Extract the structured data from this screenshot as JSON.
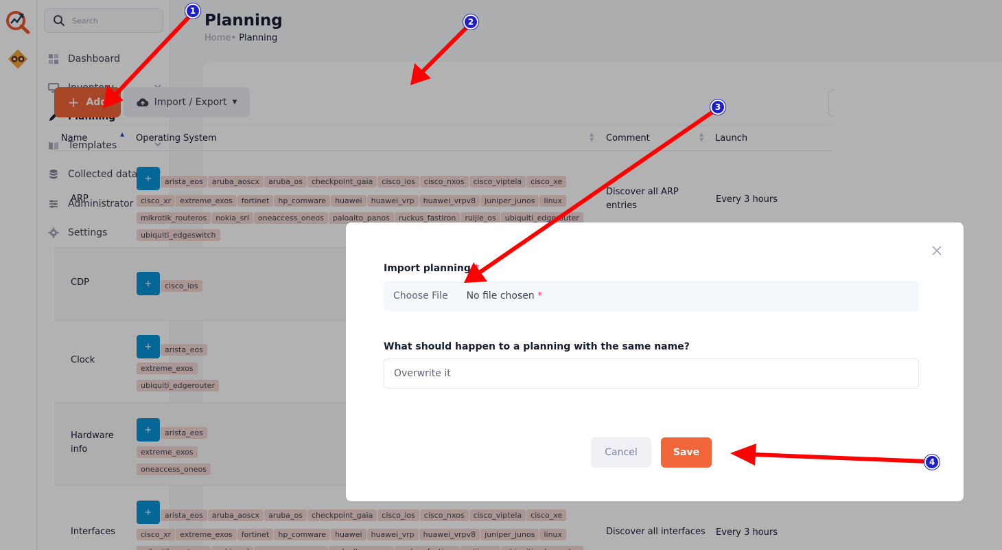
{
  "search": {
    "placeholder": "Search"
  },
  "sidebar": {
    "items": [
      {
        "label": "Dashboard",
        "expandable": false
      },
      {
        "label": "Inventory",
        "expandable": true
      },
      {
        "label": "Planning",
        "expandable": false,
        "active": true
      },
      {
        "label": "Templates",
        "expandable": true
      },
      {
        "label": "Collected data",
        "expandable": true
      },
      {
        "label": "Administrator",
        "expandable": true
      },
      {
        "label": "Settings",
        "expandable": false
      }
    ]
  },
  "page": {
    "title": "Planning",
    "breadcrumb_home": "Home",
    "breadcrumb_sep": "•",
    "breadcrumb_current": "Planning"
  },
  "toolbar": {
    "add_label": "Add",
    "import_export_label": "Import / Export"
  },
  "table": {
    "columns": [
      "Name",
      "Operating System",
      "Comment",
      "Launch"
    ],
    "plus_label": "+",
    "rows": [
      {
        "name": "ARP",
        "comment": "Discover all ARP entries",
        "launch": "Every 3 hours",
        "tags": [
          "arista_eos",
          "aruba_aoscx",
          "aruba_os",
          "checkpoint_gaia",
          "cisco_ios",
          "cisco_nxos",
          "cisco_viptela",
          "cisco_xe",
          "cisco_xr",
          "extreme_exos",
          "fortinet",
          "hp_comware",
          "huawei",
          "huawei_vrp",
          "huawei_vrpv8",
          "juniper_junos",
          "linux",
          "mikrotik_routeros",
          "nokia_srl",
          "oneaccess_oneos",
          "paloalto_panos",
          "ruckus_fastiron",
          "ruijie_os",
          "ubiquiti_edgerouter",
          "ubiquiti_edgeswitch"
        ]
      },
      {
        "name": "CDP",
        "comment": "",
        "launch": "",
        "tags": [
          "cisco_ios"
        ]
      },
      {
        "name": "Clock",
        "comment": "",
        "launch": "",
        "tags": [
          "arista_eos",
          "extreme_exos",
          "ubiquiti_edgerouter"
        ]
      },
      {
        "name": "Hardware info",
        "comment": "",
        "launch": "",
        "tags": [
          "arista_eos",
          "extreme_exos",
          "oneaccess_oneos"
        ]
      },
      {
        "name": "Interfaces",
        "comment": "Discover all interfaces",
        "launch": "Every 3 hours",
        "tags": [
          "arista_eos",
          "aruba_aoscx",
          "aruba_os",
          "checkpoint_gaia",
          "cisco_ios",
          "cisco_nxos",
          "cisco_viptela",
          "cisco_xe",
          "cisco_xr",
          "extreme_exos",
          "fortinet",
          "hp_comware",
          "huawei",
          "huawei_vrp",
          "huawei_vrpv8",
          "juniper_junos",
          "linux",
          "mikrotik_routeros",
          "nokia_srl",
          "oneaccess_oneos",
          "paloalto_panos",
          "ruckus_fastiron",
          "ruijie_os",
          "ubiquiti_edgerouter"
        ]
      }
    ]
  },
  "modal": {
    "import_label": "Import planning",
    "required_mark": "*",
    "file_button": "Choose File",
    "file_status": "No file chosen",
    "question_label": "What should happen to a planning with the same name?",
    "select_value": "Overwrite it",
    "cancel_label": "Cancel",
    "save_label": "Save"
  },
  "markers": [
    "1",
    "2",
    "3",
    "4"
  ],
  "colors": {
    "accent": "#f1653a",
    "os_button": "#0a93d6",
    "tag_bg": "#f4d7d2",
    "marker": "#1d20c9",
    "arrow": "#ff0000"
  }
}
